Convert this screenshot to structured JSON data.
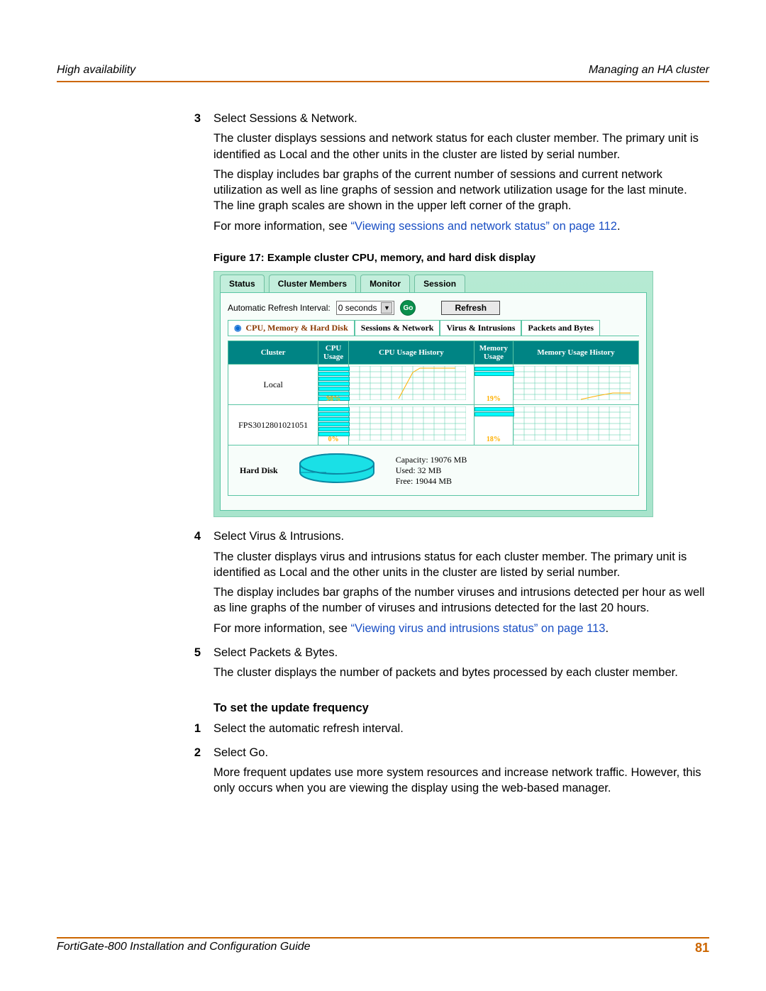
{
  "header": {
    "left": "High availability",
    "right": "Managing an HA cluster"
  },
  "steps_a": {
    "3": {
      "title": "Select Sessions & Network.",
      "p1": "The cluster displays sessions and network status for each cluster member. The primary unit is identified as Local and the other units in the cluster are listed by serial number.",
      "p2": "The display includes bar graphs of the current number of sessions and current network utilization as well as line graphs of session and network utilization usage for the last minute. The line graph scales are shown in the upper left corner of the graph.",
      "p3a": "For more information, see ",
      "p3link": "“Viewing sessions and network status” on page 112",
      "p3b": "."
    }
  },
  "figure": {
    "caption": "Figure 17: Example cluster CPU, memory, and hard disk display",
    "tabs": {
      "status": "Status",
      "members": "Cluster Members",
      "monitor": "Monitor",
      "session": "Session"
    },
    "refresh_label": "Automatic Refresh Interval:",
    "refresh_value": "0 seconds",
    "go": "Go",
    "refresh_btn": "Refresh",
    "subtabs": {
      "cpu": "CPU, Memory & Hard Disk",
      "sess": "Sessions & Network",
      "virus": "Virus & Intrusions",
      "pkt": "Packets and Bytes"
    },
    "cols": {
      "cluster": "Cluster",
      "cpu": "CPU Usage",
      "cpu_hist": "CPU Usage History",
      "mem": "Memory Usage",
      "mem_hist": "Memory Usage History"
    },
    "rows": [
      {
        "cluster": "Local",
        "cpu": "98%",
        "mem": "19%"
      },
      {
        "cluster": "FPS3012801021051",
        "cpu": "0%",
        "mem": "18%"
      }
    ],
    "hdd": {
      "label": "Hard Disk",
      "capacity": "Capacity: 19076 MB",
      "used": "Used: 32 MB",
      "free": "Free: 19044 MB"
    }
  },
  "steps_b": {
    "4": {
      "title": "Select Virus & Intrusions.",
      "p1": "The cluster displays virus and intrusions status for each cluster member. The primary unit is identified as Local and the other units in the cluster are listed by serial number.",
      "p2": "The display includes bar graphs of the number viruses and intrusions detected per hour as well as line graphs of the number of viruses and intrusions detected for the last 20 hours.",
      "p3a": "For more information, see ",
      "p3link": "“Viewing virus and intrusions status” on page 113",
      "p3b": "."
    },
    "5": {
      "title": "Select Packets & Bytes.",
      "p1": "The cluster displays the number of packets and bytes processed by each cluster member."
    }
  },
  "subhead": "To set the update frequency",
  "steps_c": {
    "1": {
      "title": "Select the automatic refresh interval."
    },
    "2": {
      "title": "Select Go.",
      "p1": "More frequent updates use more system resources and increase network traffic. However, this only occurs when you are viewing the display using the web-based manager."
    }
  },
  "footer": {
    "left": "FortiGate-800 Installation and Configuration Guide",
    "page": "81"
  }
}
